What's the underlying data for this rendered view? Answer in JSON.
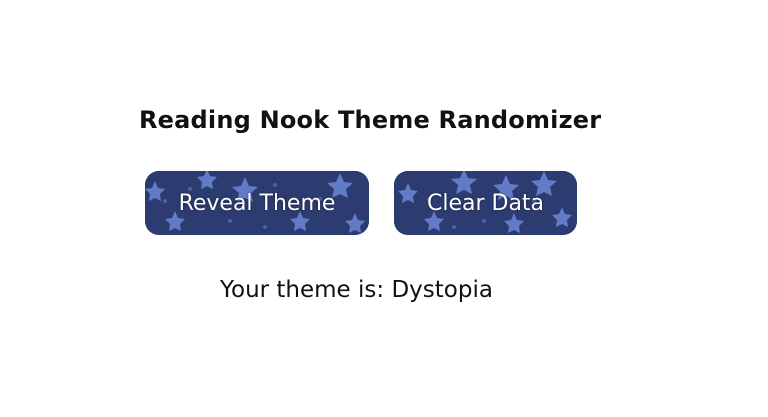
{
  "title": "Reading Nook Theme Randomizer",
  "buttons": {
    "reveal_label": "Reveal Theme",
    "clear_label": "Clear Data"
  },
  "result": {
    "text": "Your theme is: Dystopia"
  },
  "colors": {
    "button_bg": "#2c3c70",
    "star": "#6d86d6",
    "text": "#111111"
  }
}
